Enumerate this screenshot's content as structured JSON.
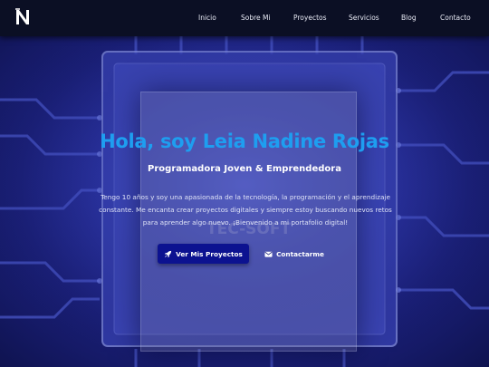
{
  "nav": {
    "logo": "N",
    "links": [
      "Inicio",
      "Sobre Mi",
      "Proyectos",
      "Servicios",
      "Blog",
      "Contacto"
    ]
  },
  "hero": {
    "title": "Hola, soy Leia Nadine Rojas",
    "subtitle": "Programadora Joven & Emprendedora",
    "description": "Tengo 10 años y soy una apasionada de la tecnología, la programación y el aprendizaje constante. Me encanta crear proyectos digitales y siempre estoy buscando nuevos retos para aprender algo nuevo. ¡Bienvenido a mi portafolio digital!",
    "primary_button": {
      "label": "Ver Mis Proyectos",
      "icon": "rocket-icon"
    },
    "secondary_button": {
      "label": "Contactarme",
      "icon": "envelope-icon"
    },
    "background_text": "TEC-SOFT"
  },
  "colors": {
    "navbar": "#0b0f24",
    "title": "#1e9ef0",
    "primary_button": "#0c1290",
    "hero_bg": "#2a32a8"
  }
}
